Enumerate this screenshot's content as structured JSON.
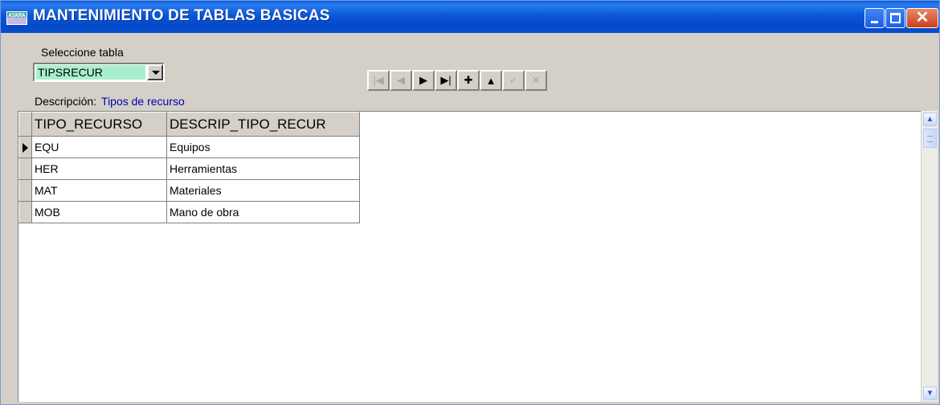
{
  "window": {
    "title": "MANTENIMIENTO DE TABLAS BASICAS",
    "icon": "app-icon",
    "icon_text": "ASKRA",
    "minimize_icon": "minimize-icon",
    "maximize_icon": "maximize-icon",
    "close_icon": "close-icon"
  },
  "table_selector": {
    "label": "Seleccione tabla",
    "value": "TIPSRECUR",
    "dropdown_icon": "chevron-down-icon"
  },
  "navigator": {
    "buttons": [
      {
        "name": "first-record",
        "glyph": "|◀",
        "enabled": false
      },
      {
        "name": "prior-record",
        "glyph": "◀",
        "enabled": false
      },
      {
        "name": "next-record",
        "glyph": "▶",
        "enabled": true
      },
      {
        "name": "last-record",
        "glyph": "▶|",
        "enabled": true
      },
      {
        "name": "insert-record",
        "glyph": "✚",
        "enabled": true
      },
      {
        "name": "delete-record",
        "glyph": "▲",
        "enabled": true
      },
      {
        "name": "post-edit",
        "glyph": "✓",
        "enabled": false
      },
      {
        "name": "cancel-edit",
        "glyph": "✕",
        "enabled": false
      }
    ]
  },
  "description": {
    "label": "Descripción:",
    "value": "Tipos de recurso"
  },
  "grid": {
    "columns": [
      "TIPO_RECURSO",
      "DESCRIP_TIPO_RECUR"
    ],
    "rows": [
      [
        "EQU",
        "Equipos"
      ],
      [
        "HER",
        "Herramientas"
      ],
      [
        "MAT",
        "Materiales"
      ],
      [
        "MOB",
        "Mano de obra"
      ]
    ],
    "current_row": 0
  },
  "colors": {
    "titlebar": "#0a57d8",
    "combo_highlight": "#a8f0cc",
    "description_value": "#0000b0",
    "window_face": "#d4d0c8"
  }
}
